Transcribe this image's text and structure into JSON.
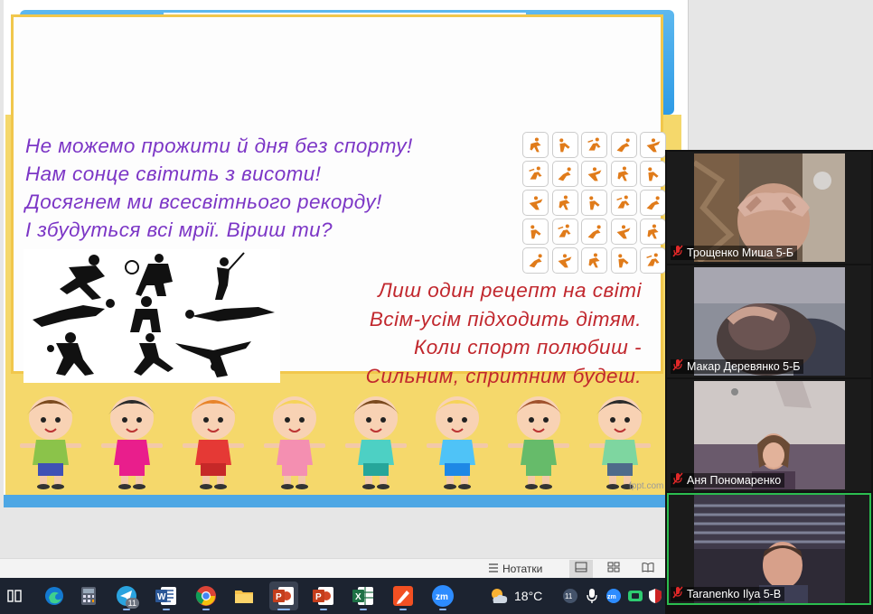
{
  "slide": {
    "poem_lines": [
      "Не можемо прожити й дня без спорту!",
      "Нам сонце світить з висоти!",
      "Досягнем ми всесвітнього рекорду!",
      "І збудуться всі мрії. Віриш ти?"
    ],
    "poem2_lines": [
      "Лиш один рецепт на світі",
      "Всім-усім підходить дітям.",
      "Коли спорт полюбиш -",
      "Сильним, спритним будеш."
    ],
    "watermark": "fppt.com",
    "colors": {
      "poem": "#7c36c6",
      "poem2": "#c1272d",
      "frame": "#f1c74c",
      "blue": "#4ea7e4"
    }
  },
  "statusbar": {
    "notes_label": "Нотатки"
  },
  "taskbar": {
    "weather": "18°C",
    "apps": [
      "task-view-icon",
      "edge-icon",
      "calculator-icon",
      "telegram-icon",
      "word-icon",
      "chrome-icon",
      "file-explorer-icon",
      "powerpoint-icon",
      "powerpoint-icon",
      "excel-icon",
      "ink-icon",
      "zoom-icon"
    ],
    "telegram_badge": "11",
    "tray_badge": "11"
  },
  "participants": [
    {
      "name": "Трощенко Миша 5-Б",
      "muted": true
    },
    {
      "name": "Макар Деревянко 5-Б",
      "muted": true
    },
    {
      "name": "Аня Пономаренко",
      "muted": true
    },
    {
      "name": "Taranenko Ilya 5-B",
      "muted": true
    }
  ]
}
